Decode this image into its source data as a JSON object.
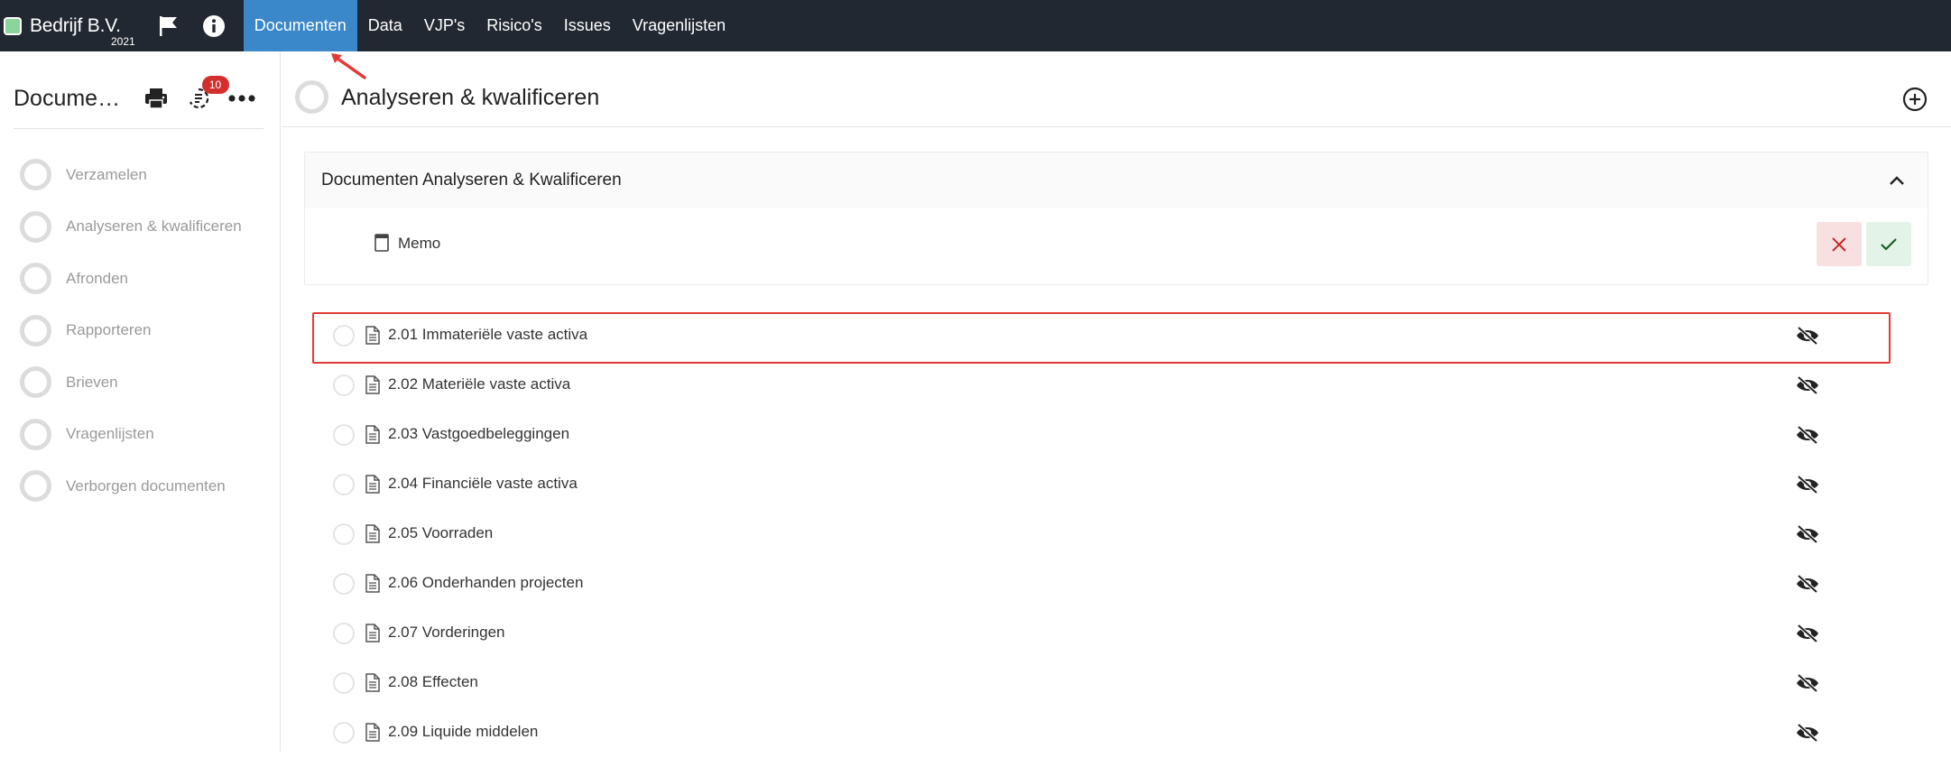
{
  "brand": {
    "name": "Bedrijf B.V.",
    "year": "2021",
    "status_color": "#8bd59b"
  },
  "nav": {
    "icons": [
      "flag-icon",
      "info-icon"
    ],
    "items": [
      {
        "label": "Documenten",
        "active": true
      },
      {
        "label": "Data",
        "active": false
      },
      {
        "label": "VJP's",
        "active": false
      },
      {
        "label": "Risico's",
        "active": false
      },
      {
        "label": "Issues",
        "active": false
      },
      {
        "label": "Vragenlijsten",
        "active": false
      }
    ],
    "active_color": "#3a87c9",
    "bar_color": "#222831"
  },
  "sidebar": {
    "title": "Documenten",
    "badge_count": "10",
    "items": [
      {
        "label": "Verzamelen"
      },
      {
        "label": "Analyseren & kwalificeren"
      },
      {
        "label": "Afronden"
      },
      {
        "label": "Rapporteren"
      },
      {
        "label": "Brieven"
      },
      {
        "label": "Vragenlijsten"
      },
      {
        "label": "Verborgen documenten"
      }
    ]
  },
  "main": {
    "title": "Analyseren & kwalificeren",
    "panel": {
      "title": "Documenten Analyseren & Kwalificeren",
      "memo_label": "Memo"
    },
    "documents": [
      {
        "label": "2.01 Immateriële vaste activa",
        "highlighted": true
      },
      {
        "label": "2.02 Materiële vaste activa"
      },
      {
        "label": "2.03 Vastgoedbeleggingen"
      },
      {
        "label": "2.04 Financiële vaste activa"
      },
      {
        "label": "2.05 Voorraden"
      },
      {
        "label": "2.06 Onderhanden projecten"
      },
      {
        "label": "2.07 Vorderingen"
      },
      {
        "label": "2.08 Effecten"
      },
      {
        "label": "2.09 Liquide middelen"
      }
    ]
  },
  "annotation_color": "#e53935"
}
